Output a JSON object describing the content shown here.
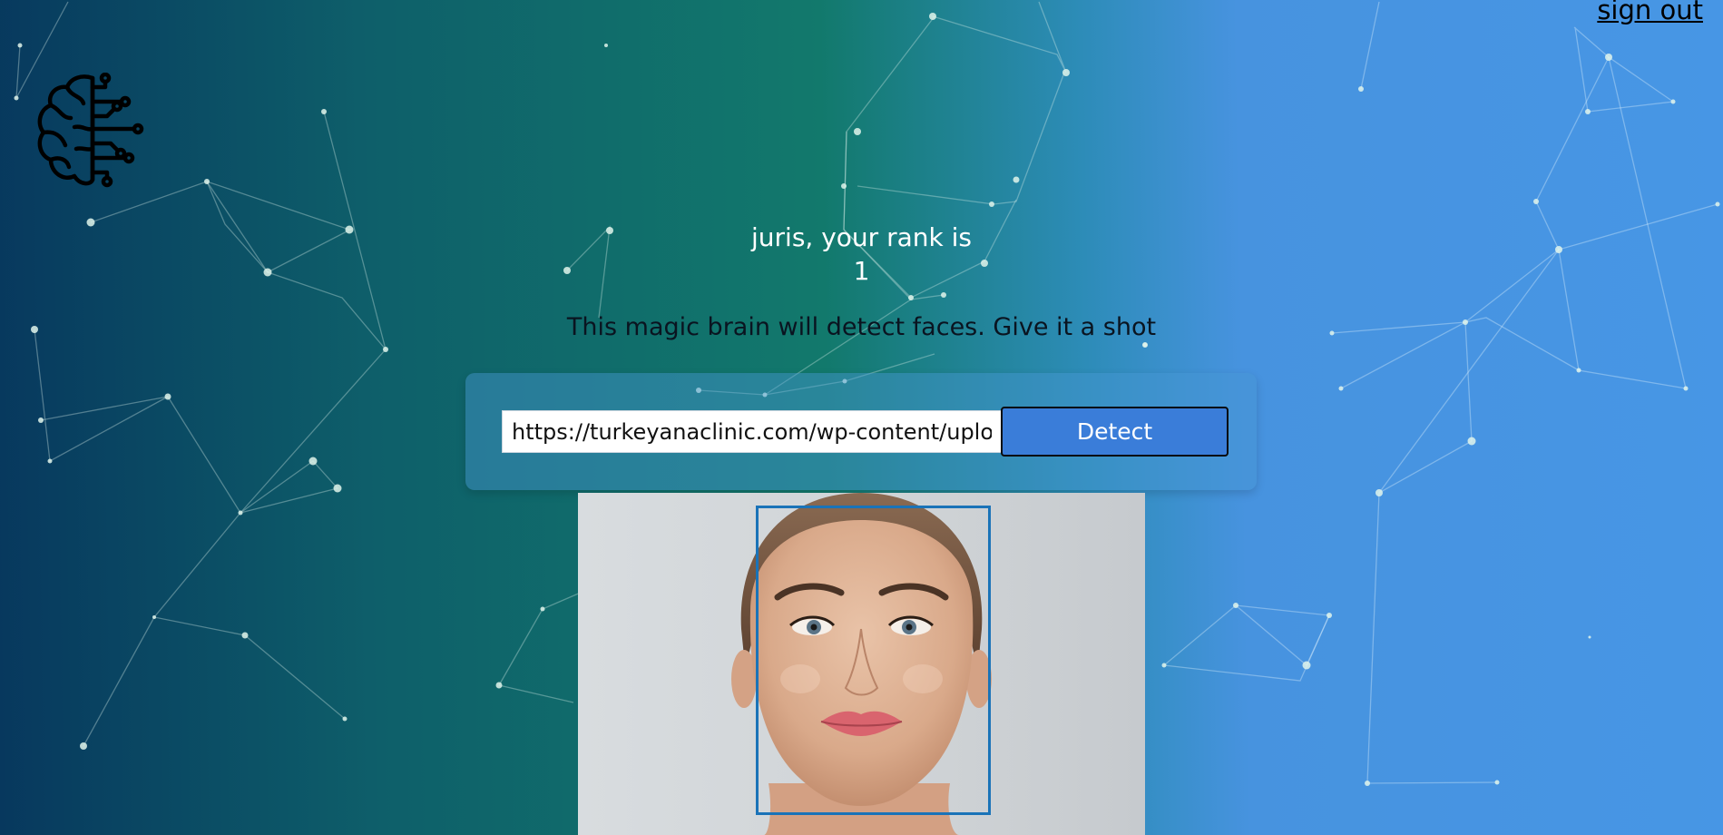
{
  "header": {
    "signout_label": "sign out"
  },
  "logo": {
    "icon": "brain-circuit-icon"
  },
  "rank": {
    "title": "juris, your rank is",
    "value": "1"
  },
  "tagline": "This magic brain will detect faces. Give it a shot",
  "form": {
    "url_value": "https://turkeyanaclinic.com/wp-content/uploads",
    "detect_label": "Detect"
  },
  "result": {
    "image_subject": "face-portrait",
    "face_count": 1
  },
  "colors": {
    "gradient_start": "#07385e",
    "gradient_mid": "#12796c",
    "gradient_end": "#4796e5",
    "button": "#3a7dd9",
    "face_box": "#1a73b8"
  }
}
